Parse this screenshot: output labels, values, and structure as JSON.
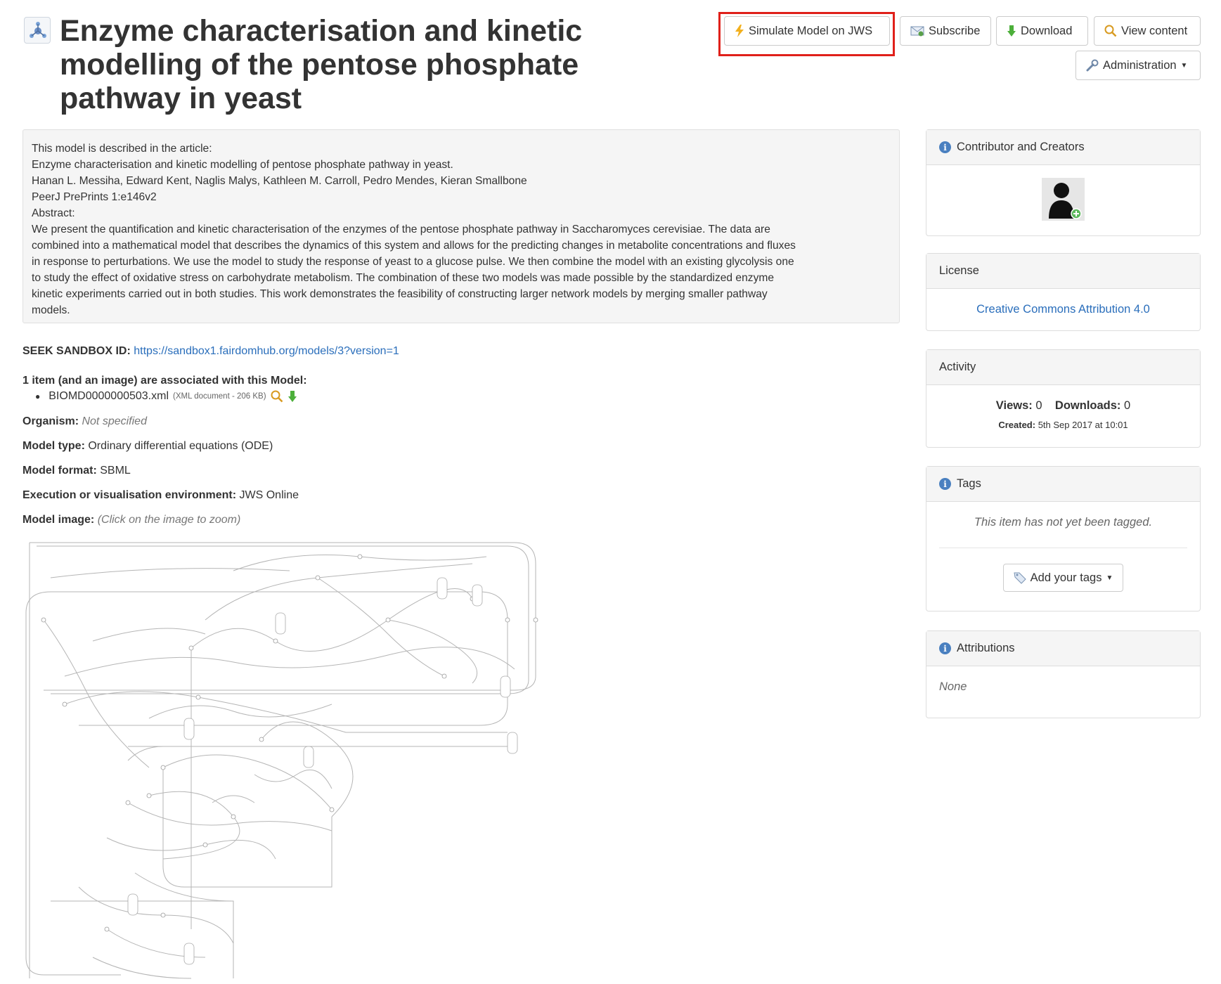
{
  "page": {
    "title": "Enzyme characterisation and kinetic modelling of the pentose phosphate pathway in yeast"
  },
  "actions": {
    "simulate_label": "Simulate Model on JWS",
    "subscribe_label": "Subscribe",
    "download_label": "Download",
    "view_content_label": "View content",
    "administration_label": "Administration",
    "highlight_color": "#e0201a"
  },
  "abstract": {
    "lines": [
      "This model is described in the article:",
      "Enzyme characterisation and kinetic modelling of pentose phosphate pathway in yeast.",
      "Hanan L. Messiha, Edward Kent, Naglis Malys, Kathleen M. Carroll, Pedro Mendes, Kieran Smallbone",
      "PeerJ PrePrints 1:e146v2",
      "Abstract:",
      "We present the quantification and kinetic characterisation of the enzymes of the pentose phosphate pathway in Saccharomyces cerevisiae. The data are",
      "combined into a mathematical model that describes the dynamics of this system and allows for the predicting changes in metabolite concentrations and fluxes",
      "in response to perturbations. We use the model to study the response of yeast to a glucose pulse. We then combine the model with an existing glycolysis one",
      "to study the effect of oxidative stress on carbohydrate metabolism. The combination of these two models was made possible by the standardized enzyme",
      "kinetic experiments carried out in both studies. This work demonstrates the feasibility of constructing larger network models by merging smaller pathway",
      "models."
    ]
  },
  "details": {
    "seek_id_label": "SEEK SANDBOX ID:",
    "seek_id_url": "https://sandbox1.fairdomhub.org/models/3?version=1",
    "associated_heading": "1 item (and an image) are associated with this Model:",
    "file_name": "BIOMD0000000503.xml",
    "file_meta": "(XML document - 206 KB)",
    "organism_label": "Organism:",
    "organism_value": "Not specified",
    "model_type_label": "Model type:",
    "model_type_value": "Ordinary differential equations (ODE)",
    "model_format_label": "Model format:",
    "model_format_value": "SBML",
    "exec_env_label": "Execution or visualisation environment:",
    "exec_env_value": "JWS Online",
    "model_image_label": "Model image:",
    "model_image_hint": "(Click on the image to zoom)"
  },
  "sidebar": {
    "contributors": {
      "title": "Contributor and Creators"
    },
    "license": {
      "title": "License",
      "value": "Creative Commons Attribution 4.0"
    },
    "activity": {
      "title": "Activity",
      "views_label": "Views:",
      "views_value": "0",
      "downloads_label": "Downloads:",
      "downloads_value": "0",
      "created_label": "Created:",
      "created_value": "5th Sep 2017 at 10:01"
    },
    "tags": {
      "title": "Tags",
      "empty_text": "This item has not yet been tagged.",
      "add_label": "Add your tags"
    },
    "attributions": {
      "title": "Attributions",
      "value": "None"
    }
  }
}
